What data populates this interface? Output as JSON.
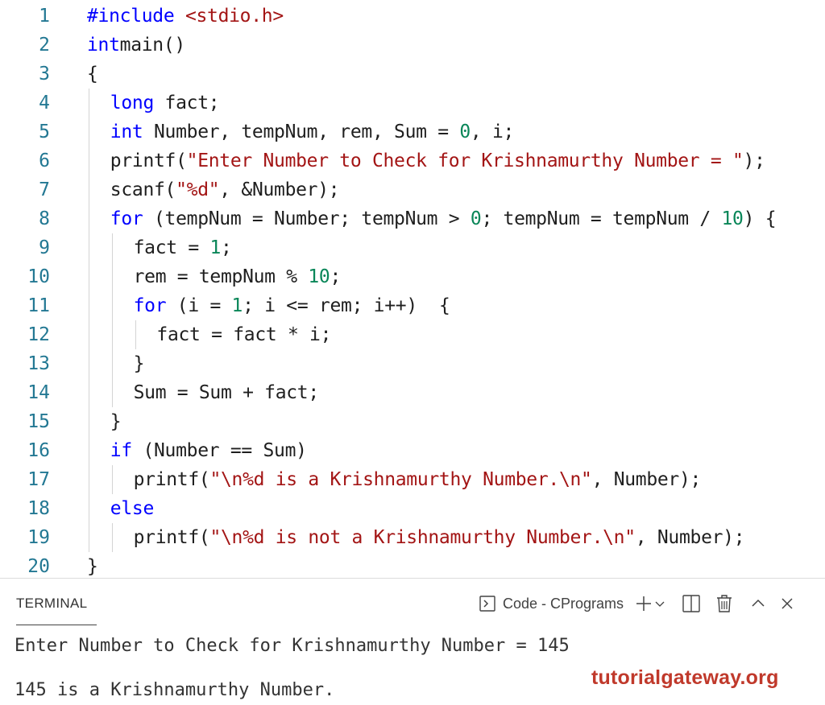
{
  "editor": {
    "lines": [
      {
        "n": "1",
        "tokens": [
          [
            "pp",
            "#include "
          ],
          [
            "inc",
            "<stdio.h>"
          ]
        ]
      },
      {
        "n": "2",
        "tokens": [
          [
            "kw",
            "int"
          ],
          [
            "",
            "main()"
          ]
        ]
      },
      {
        "n": "3",
        "tokens": [
          [
            "",
            "{"
          ]
        ]
      },
      {
        "n": "4",
        "tokens": [
          [
            "kw",
            "long"
          ],
          [
            "",
            " fact;"
          ]
        ]
      },
      {
        "n": "5",
        "tokens": [
          [
            "kw",
            "int"
          ],
          [
            "",
            " Number, tempNum, rem, Sum = "
          ],
          [
            "num",
            "0"
          ],
          [
            "",
            ", i;"
          ]
        ]
      },
      {
        "n": "6",
        "tokens": [
          [
            "",
            "printf("
          ],
          [
            "str",
            "\"Enter Number to Check for Krishnamurthy Number = \""
          ],
          [
            "",
            ");"
          ]
        ]
      },
      {
        "n": "7",
        "tokens": [
          [
            "",
            "scanf("
          ],
          [
            "str",
            "\"%d\""
          ],
          [
            "",
            ", &Number);"
          ]
        ]
      },
      {
        "n": "8",
        "tokens": [
          [
            "kw",
            "for"
          ],
          [
            "",
            " (tempNum = Number; tempNum > "
          ],
          [
            "num",
            "0"
          ],
          [
            "",
            "; tempNum = tempNum / "
          ],
          [
            "num",
            "10"
          ],
          [
            "",
            ") {"
          ]
        ]
      },
      {
        "n": "9",
        "tokens": [
          [
            "",
            "fact = "
          ],
          [
            "num",
            "1"
          ],
          [
            "",
            ";"
          ]
        ]
      },
      {
        "n": "10",
        "tokens": [
          [
            "",
            "rem = tempNum % "
          ],
          [
            "num",
            "10"
          ],
          [
            "",
            ";"
          ]
        ]
      },
      {
        "n": "11",
        "tokens": [
          [
            "kw",
            "for"
          ],
          [
            "",
            " (i = "
          ],
          [
            "num",
            "1"
          ],
          [
            "",
            "; i <= rem; i++)  {"
          ]
        ]
      },
      {
        "n": "12",
        "tokens": [
          [
            "",
            "fact = fact * i;"
          ]
        ]
      },
      {
        "n": "13",
        "tokens": [
          [
            "",
            "}"
          ]
        ]
      },
      {
        "n": "14",
        "tokens": [
          [
            "",
            "Sum = Sum + fact;"
          ]
        ]
      },
      {
        "n": "15",
        "tokens": [
          [
            "",
            "}"
          ]
        ]
      },
      {
        "n": "16",
        "tokens": [
          [
            "kw",
            "if"
          ],
          [
            "",
            " (Number == Sum)"
          ]
        ]
      },
      {
        "n": "17",
        "tokens": [
          [
            "",
            "printf("
          ],
          [
            "str",
            "\"\\n%d is a Krishnamurthy Number.\\n\""
          ],
          [
            "",
            ", Number);"
          ]
        ]
      },
      {
        "n": "18",
        "tokens": [
          [
            "kw",
            "else"
          ]
        ]
      },
      {
        "n": "19",
        "tokens": [
          [
            "",
            "printf("
          ],
          [
            "str",
            "\"\\n%d is not a Krishnamurthy Number.\\n\""
          ],
          [
            "",
            ", Number);"
          ]
        ]
      },
      {
        "n": "20",
        "tokens": [
          [
            "",
            "}"
          ]
        ]
      }
    ]
  },
  "terminal": {
    "tab_label": "TERMINAL",
    "shell_label": "Code - CPrograms",
    "output": [
      "Enter Number to Check for Krishnamurthy Number = 145",
      "145 is a Krishnamurthy Number."
    ]
  },
  "watermark": {
    "text": "tutorialgateway.org"
  },
  "icons": {
    "shell": "terminal-shell-icon",
    "add": "plus-icon",
    "dropdown": "chevron-down-icon",
    "split": "split-terminal-icon",
    "trash": "trash-icon",
    "maximize": "chevron-up-icon",
    "close": "close-icon"
  },
  "colors": {
    "keyword": "#0000ff",
    "string": "#a31515",
    "number": "#098658",
    "line_number": "#237893",
    "watermark": "#c0392b"
  }
}
